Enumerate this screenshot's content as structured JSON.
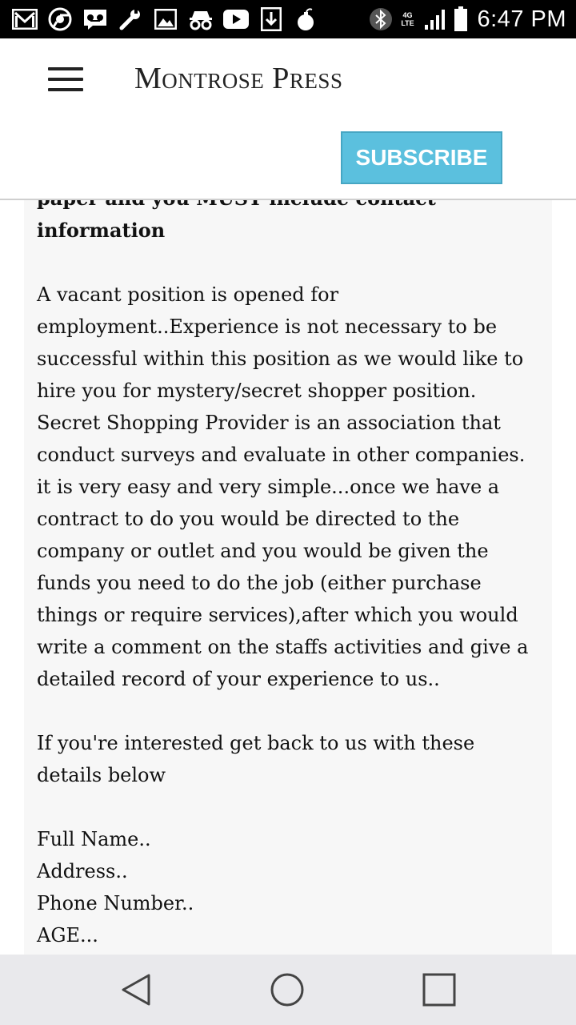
{
  "status_bar": {
    "time": "6:47 PM",
    "network": "4G LTE",
    "icons": [
      "gmail-icon",
      "chrome-icon",
      "voicemail-icon",
      "wrench-icon",
      "gallery-icon",
      "incognito-icon",
      "youtube-icon",
      "download-icon",
      "bomb-icon",
      "bluetooth-icon",
      "signal-icon",
      "battery-icon"
    ]
  },
  "header": {
    "brand": "Montrose Press",
    "subscribe_label": "SUBSCRIBE",
    "menu_icon": "hamburger-menu-icon"
  },
  "article": {
    "cut_line": "paper and you MUST include contact",
    "bold_tail": "information",
    "paragraph1": "A vacant position is opened for employment..Experience is not necessary to be successful within this position as we would like to hire you for mystery/secret shopper position.",
    "paragraph2": "Secret Shopping Provider is an association that conduct surveys and evaluate in other companies. it is very easy and very simple...once we have a contract to do you would be directed to the company or outlet and you would be given the funds you need to do the job (either purchase things or require services),after which you would write a comment on the staffs activities and give a detailed record of your experience to us..",
    "paragraph3": "If you're interested get back to us with these details below",
    "details": [
      "Full Name..",
      "Address..",
      "Phone Number..",
      "AGE..."
    ]
  },
  "nav_bar": {
    "back_icon": "back-triangle-icon",
    "home_icon": "home-circle-icon",
    "recents_icon": "recents-square-icon"
  }
}
